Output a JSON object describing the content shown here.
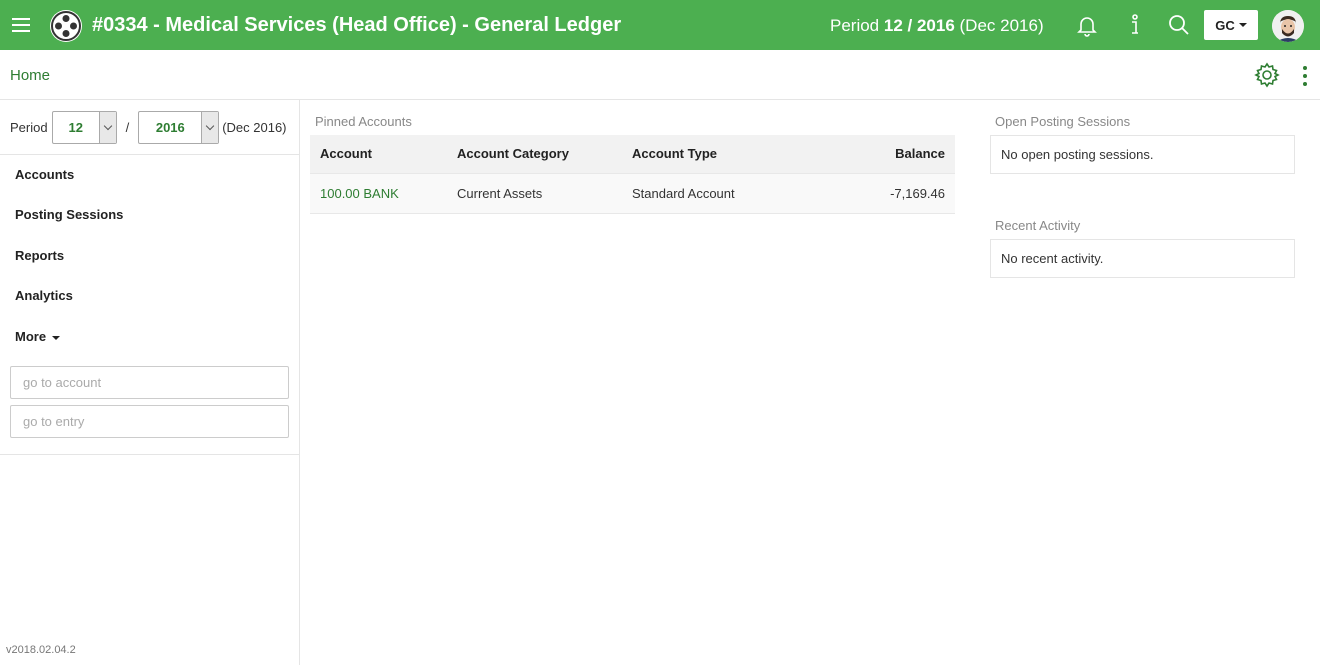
{
  "header": {
    "title": "#0334 - Medical Services (Head Office) - General Ledger",
    "period_prefix": "Period ",
    "period_month": "12",
    "period_slash": " / ",
    "period_year": "2016",
    "period_suffix": " (Dec 2016)",
    "user_initials": "GC",
    "icons": [
      "menu-icon",
      "app-logo-icon",
      "bell-icon",
      "info-icon",
      "search-icon",
      "avatar"
    ]
  },
  "subheader": {
    "home_label": "Home",
    "icons": [
      "gear-icon",
      "kebab-menu-icon"
    ]
  },
  "sidebar": {
    "period_label": "Period",
    "month_value": "12",
    "year_value": "2016",
    "separator": "/",
    "period_text": "(Dec 2016)",
    "nav": {
      "accounts": "Accounts",
      "posting_sessions": "Posting Sessions",
      "reports": "Reports",
      "analytics": "Analytics",
      "more": "More"
    },
    "goto_account_placeholder": "go to account",
    "goto_entry_placeholder": "go to entry",
    "version": "v2018.02.04.2"
  },
  "pinned": {
    "label": "Pinned Accounts",
    "columns": [
      "Account",
      "Account Category",
      "Account Type",
      "Balance"
    ],
    "rows": [
      {
        "account": "100.00 BANK",
        "category": "Current Assets",
        "type": "Standard Account",
        "balance": "-7,169.46"
      }
    ]
  },
  "open_sessions": {
    "label": "Open Posting Sessions",
    "empty_text": "No open posting sessions."
  },
  "recent_activity": {
    "label": "Recent Activity",
    "empty_text": "No recent activity."
  },
  "colors": {
    "brand_green": "#4caf50",
    "link_green": "#2e7d32"
  }
}
